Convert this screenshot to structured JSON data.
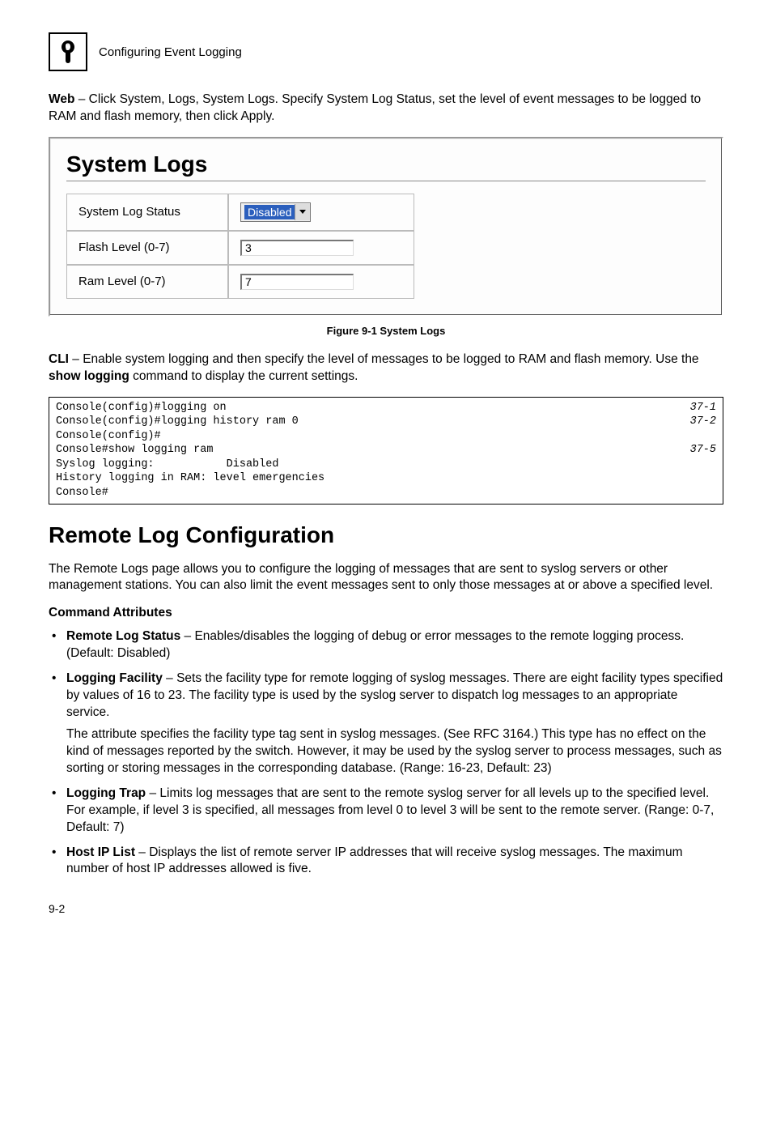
{
  "header": {
    "chapter_number": "9",
    "chapter_title": "Configuring Event Logging"
  },
  "intro": {
    "web_label": "Web",
    "web_text": " – Click System, Logs, System Logs. Specify System Log Status, set the level of event messages to be logged to RAM and flash memory, then click Apply."
  },
  "panel": {
    "title": "System Logs",
    "rows": [
      {
        "label": "System Log Status",
        "control_type": "select",
        "value": "Disabled"
      },
      {
        "label": "Flash Level (0-7)",
        "control_type": "input",
        "value": "3"
      },
      {
        "label": "Ram Level (0-7)",
        "control_type": "input",
        "value": "7"
      }
    ]
  },
  "figure_caption": "Figure 9-1  System Logs",
  "cli_intro": {
    "cli_label": "CLI",
    "text_before_bold": " – Enable system logging and then specify the level of messages to be logged to RAM and flash memory. Use the ",
    "bold_cmd": "show logging",
    "text_after_bold": " command to display the current settings."
  },
  "code": {
    "lines": [
      {
        "text": "Console(config)#logging on",
        "ref": "37-1"
      },
      {
        "text": "Console(config)#logging history ram 0",
        "ref": "37-2"
      },
      {
        "text": "Console(config)#",
        "ref": ""
      },
      {
        "text": "Console#show logging ram",
        "ref": "37-5"
      },
      {
        "text": "Syslog logging:           Disabled",
        "ref": ""
      },
      {
        "text": "History logging in RAM: level emergencies",
        "ref": ""
      },
      {
        "text": "Console#",
        "ref": ""
      }
    ]
  },
  "section_title": "Remote Log Configuration",
  "section_intro": "The Remote Logs page allows you to configure the logging of messages that are sent to syslog servers or other management stations. You can also limit the event messages sent to only those messages at or above a specified level.",
  "command_attributes_heading": "Command Attributes",
  "bullets": [
    {
      "bold": "Remote Log Status",
      "text": " – Enables/disables the logging of debug or error messages to the remote logging process. (Default: Disabled)"
    },
    {
      "bold": "Logging Facility",
      "text": " – Sets the facility type for remote logging of syslog messages. There are eight facility types specified by values of 16 to 23. The facility type is used by the syslog server to dispatch log messages to an appropriate service.",
      "extra": "The attribute specifies the facility type tag sent in syslog messages. (See RFC 3164.) This type has no effect on the kind of messages reported by the switch. However, it may be used by the syslog server to process messages, such as sorting or storing messages in the corresponding database. (Range: 16-23, Default: 23)"
    },
    {
      "bold": "Logging Trap",
      "text": " – Limits log messages that are sent to the remote syslog server for all levels up to the specified level. For example, if level 3 is specified, all messages from level 0 to level 3 will be sent to the remote server. (Range: 0-7, Default: 7)"
    },
    {
      "bold": "Host IP List",
      "text": " – Displays the list of remote server IP addresses that will receive syslog messages. The maximum number of host IP addresses allowed is five."
    }
  ],
  "page_number": "9-2"
}
